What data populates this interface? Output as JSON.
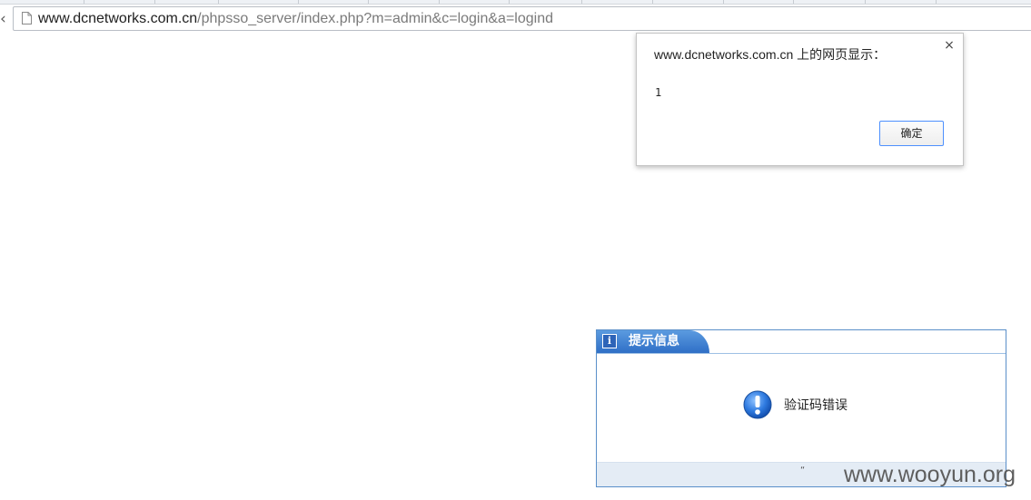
{
  "browser": {
    "nav_back_glyph": "‹",
    "address_bar": {
      "host": "www.dcnetworks.com.cn",
      "path": "/phpsso_server/index.php?m=admin&c=login&a=logind",
      "icon": "page-icon"
    }
  },
  "alert": {
    "title": "www.dcnetworks.com.cn 上的网页显示：",
    "message": "1",
    "ok_label": "确定",
    "close_glyph": "×",
    "close_icon": "close-icon"
  },
  "message_box": {
    "title": "提示信息",
    "info_icon": "info-icon",
    "info_glyph": "i",
    "status_icon": "exclamation-icon",
    "text": "验证码错误",
    "footer_mark": "“",
    "colors": {
      "border": "#5a8fc9",
      "header_tab": "#2f6fc6",
      "footer": "#e4ecf5"
    }
  },
  "watermark": {
    "text": "www.wooyun.org"
  }
}
